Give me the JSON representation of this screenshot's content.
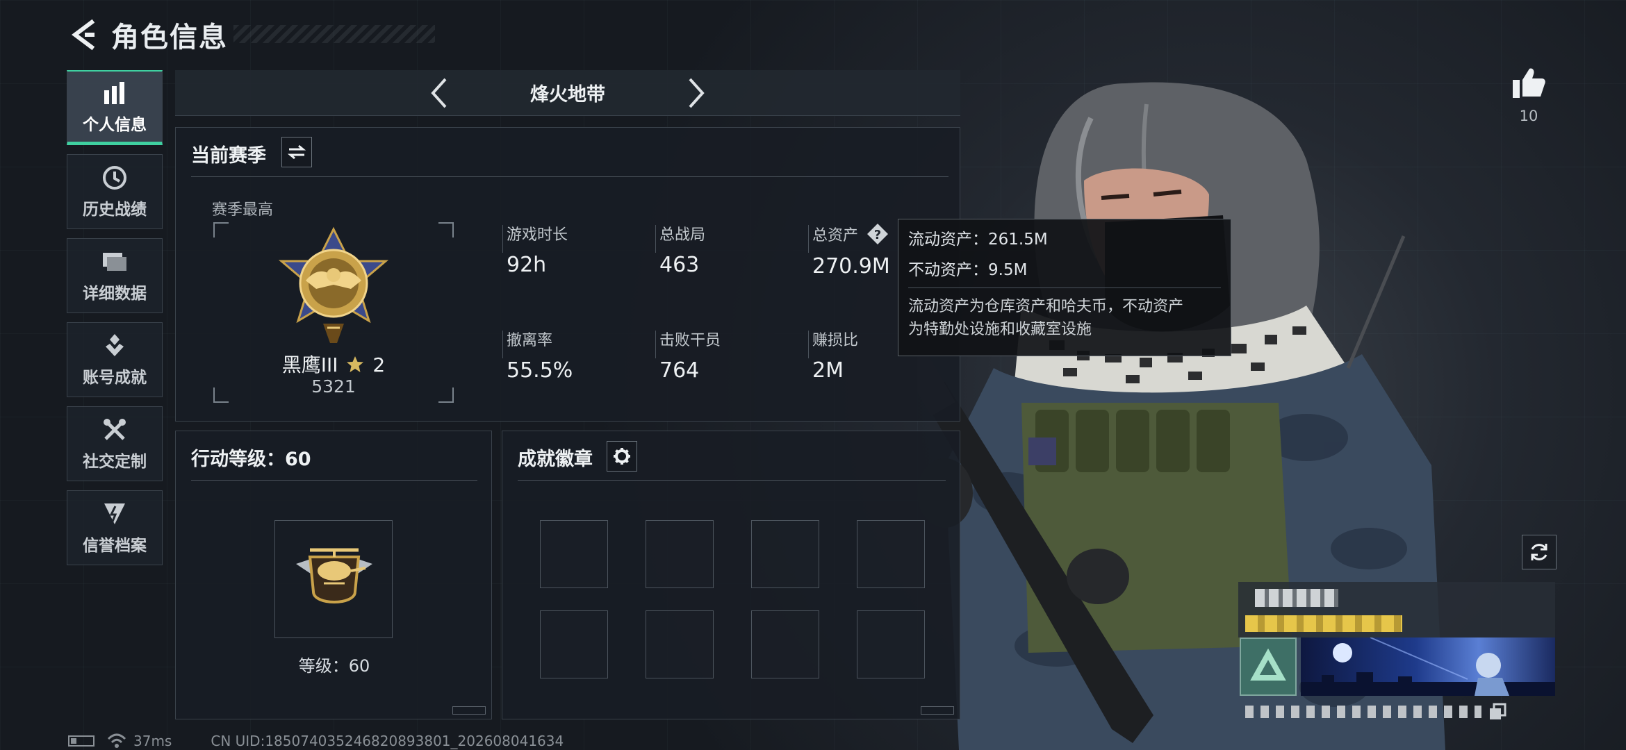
{
  "header": {
    "title": "角色信息"
  },
  "nav": [
    {
      "label": "个人信息",
      "icon": "bar-chart-icon",
      "active": true
    },
    {
      "label": "历史战绩",
      "icon": "history-icon"
    },
    {
      "label": "详细数据",
      "icon": "folder-icon"
    },
    {
      "label": "账号成就",
      "icon": "achievement-icon"
    },
    {
      "label": "社交定制",
      "icon": "tools-icon"
    },
    {
      "label": "信誉档案",
      "icon": "credit-icon"
    }
  ],
  "map": {
    "name": "烽火地带"
  },
  "season": {
    "title": "当前赛季",
    "best_label": "赛季最高",
    "rank_name": "黑鹰III",
    "rank_stars": "2",
    "rank_score": "5321",
    "stats": [
      {
        "label": "游戏时长",
        "value": "92h"
      },
      {
        "label": "总战局",
        "value": "463"
      },
      {
        "label": "总资产",
        "value": "270.9M"
      },
      {
        "label": "撤离率",
        "value": "55.5%"
      },
      {
        "label": "击败干员",
        "value": "764"
      },
      {
        "label": "赚损比",
        "value": "2M"
      }
    ]
  },
  "tooltip": {
    "liquid": "流动资产：261.5M",
    "fixed": "不动资产：9.5M",
    "note_line1": "流动资产为仓库资产和哈夫币，不动资产",
    "note_line2": "为特勤处设施和收藏室设施"
  },
  "action_level": {
    "title": "行动等级：60",
    "level_text": "等级：60"
  },
  "achievements": {
    "title": "成就徽章",
    "slots": 8
  },
  "like": {
    "count": "10"
  },
  "footer": {
    "ping": "37ms",
    "uid": "CN UID:185074035246820893801_202608041634"
  },
  "colors": {
    "accent": "#3fd0a0",
    "gold": "#c9a24a",
    "panel": "#181d24"
  }
}
